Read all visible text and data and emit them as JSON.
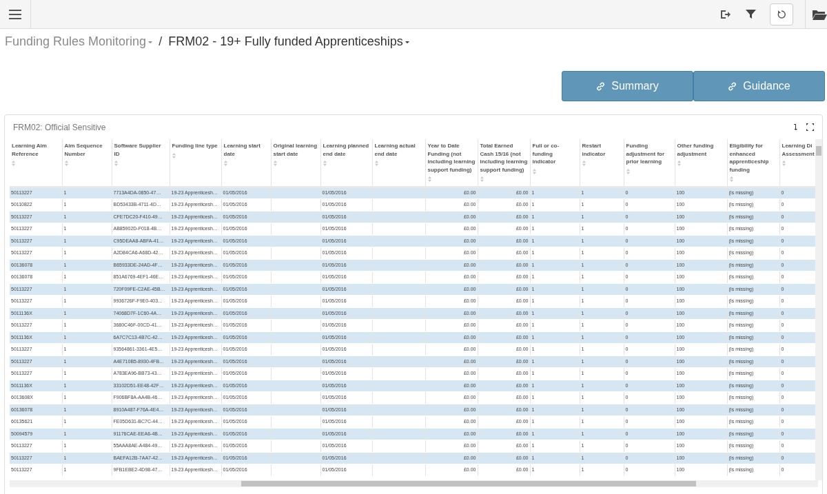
{
  "breadcrumb": {
    "separator": "/",
    "items": [
      {
        "label": "Funding Rules Monitoring",
        "current": false
      },
      {
        "label": "FRM02 - 19+ Fully funded Apprenticeships",
        "current": true
      }
    ]
  },
  "buttons": [
    {
      "label": "Summary"
    },
    {
      "label": "Guidance"
    }
  ],
  "panel": {
    "title": "FRM02: Official Sensitive"
  },
  "table": {
    "columns": [
      {
        "label": "Learning Aim Reference",
        "kind": "text"
      },
      {
        "label": "Aim Sequence Number",
        "kind": "text"
      },
      {
        "label": "Software Supplier ID",
        "kind": "text"
      },
      {
        "label": "Funding line type",
        "kind": "text"
      },
      {
        "label": "Learning start date",
        "kind": "text"
      },
      {
        "label": "Original learning start date",
        "kind": "text"
      },
      {
        "label": "Learning planned end date",
        "kind": "text"
      },
      {
        "label": "Learning actual end date",
        "kind": "text"
      },
      {
        "label": "Year to Date Funding (not including learning support funding)",
        "kind": "money"
      },
      {
        "label": "Total Earned Cash 15/16 (not including learning support funding)",
        "kind": "money"
      },
      {
        "label": "Full or co-funding indicator",
        "kind": "text"
      },
      {
        "label": "Restart indicator",
        "kind": "text"
      },
      {
        "label": "Funding adjustment for prior learning",
        "kind": "text"
      },
      {
        "label": "Other funding adjustment",
        "kind": "text"
      },
      {
        "label": "Eligibility for enhanced apprenticeship funding",
        "kind": "text"
      },
      {
        "label": "Learning Di Assessment",
        "kind": "text"
      }
    ],
    "rows": [
      [
        "50113227",
        "1",
        "7713A4DA-0850-47…",
        "19-23 Apprenticesh…",
        "01/05/2016",
        "",
        "01/05/2016",
        "",
        "£0.00",
        "£0.00",
        "1",
        "1",
        "0",
        "100",
        "(Is missing)",
        "0"
      ],
      [
        "50110822",
        "1",
        "BD53433B-4711-4D…",
        "19-23 Apprenticesh…",
        "01/05/2016",
        "",
        "01/05/2016",
        "",
        "£0.00",
        "£0.00",
        "1",
        "1",
        "0",
        "100",
        "(Is missing)",
        "0"
      ],
      [
        "50113227",
        "1",
        "CFE7DC20-F410-49…",
        "19-23 Apprenticesh…",
        "01/05/2016",
        "",
        "01/05/2016",
        "",
        "£0.00",
        "£0.00",
        "1",
        "1",
        "0",
        "100",
        "(Is missing)",
        "0"
      ],
      [
        "50113227",
        "1",
        "AB85902D-F018-4B…",
        "19-23 Apprenticesh…",
        "01/05/2016",
        "",
        "01/05/2016",
        "",
        "£0.00",
        "£0.00",
        "1",
        "1",
        "0",
        "100",
        "(Is missing)",
        "0"
      ],
      [
        "50113227",
        "1",
        "C95DEAA8-ABFA-41…",
        "19-23 Apprenticesh…",
        "01/05/2016",
        "",
        "01/05/2016",
        "",
        "£0.00",
        "£0.00",
        "1",
        "1",
        "0",
        "100",
        "(Is missing)",
        "0"
      ],
      [
        "50113227",
        "1",
        "A2D84CA6-A68D-42…",
        "19-23 Apprenticesh…",
        "01/05/2016",
        "",
        "01/05/2016",
        "",
        "£0.00",
        "£0.00",
        "1",
        "1",
        "0",
        "100",
        "(Is missing)",
        "0"
      ],
      [
        "60136078",
        "1",
        "B65933DE-24AD-4F…",
        "19-23 Apprenticesh…",
        "01/05/2016",
        "",
        "01/05/2016",
        "",
        "£0.00",
        "£0.00",
        "1",
        "1",
        "0",
        "100",
        "(Is missing)",
        "0"
      ],
      [
        "60136078",
        "1",
        "851A6769-4EF1-46E…",
        "19-23 Apprenticesh…",
        "01/05/2016",
        "",
        "01/05/2016",
        "",
        "£0.00",
        "£0.00",
        "1",
        "1",
        "0",
        "100",
        "(Is missing)",
        "0"
      ],
      [
        "50113227",
        "1",
        "720F09FE-C2AE-45B…",
        "19-23 Apprenticesh…",
        "01/05/2016",
        "",
        "01/05/2016",
        "",
        "£0.00",
        "£0.00",
        "1",
        "1",
        "0",
        "100",
        "(Is missing)",
        "0"
      ],
      [
        "50113227",
        "1",
        "9936726F-F9E0-403…",
        "19-23 Apprenticesh…",
        "01/05/2016",
        "",
        "01/05/2016",
        "",
        "£0.00",
        "£0.00",
        "1",
        "1",
        "0",
        "100",
        "(Is missing)",
        "0"
      ],
      [
        "5011136X",
        "1",
        "74068D7F-1C60-4A…",
        "19-23 Apprenticesh…",
        "01/05/2016",
        "",
        "01/05/2016",
        "",
        "£0.00",
        "£0.00",
        "1",
        "1",
        "0",
        "100",
        "(Is missing)",
        "0"
      ],
      [
        "50113227",
        "1",
        "3680C46F-00CD-41…",
        "19-23 Apprenticesh…",
        "01/05/2016",
        "",
        "01/05/2016",
        "",
        "£0.00",
        "£0.00",
        "1",
        "1",
        "0",
        "100",
        "(Is missing)",
        "0"
      ],
      [
        "5011136X",
        "1",
        "6A7C7C13-4B7C-42…",
        "19-23 Apprenticesh…",
        "01/05/2016",
        "",
        "01/05/2016",
        "",
        "£0.00",
        "£0.00",
        "1",
        "1",
        "0",
        "100",
        "(Is missing)",
        "0"
      ],
      [
        "50113227",
        "1",
        "93564861-3361-4E5…",
        "19-23 Apprenticesh…",
        "01/05/2016",
        "",
        "01/05/2016",
        "",
        "£0.00",
        "£0.00",
        "1",
        "1",
        "0",
        "100",
        "(Is missing)",
        "0"
      ],
      [
        "50113227",
        "1",
        "A4E710B5-8930-4FB…",
        "19-23 Apprenticesh…",
        "01/05/2016",
        "",
        "01/05/2016",
        "",
        "£0.00",
        "£0.00",
        "1",
        "1",
        "0",
        "100",
        "(Is missing)",
        "0"
      ],
      [
        "50113227",
        "1",
        "A783EA96-BB73-43…",
        "19-23 Apprenticesh…",
        "01/05/2016",
        "",
        "01/05/2016",
        "",
        "£0.00",
        "£0.00",
        "1",
        "1",
        "0",
        "100",
        "(Is missing)",
        "0"
      ],
      [
        "5011136X",
        "1",
        "33102D51-EE48-42F…",
        "19-23 Apprenticesh…",
        "01/05/2016",
        "",
        "01/05/2016",
        "",
        "£0.00",
        "£0.00",
        "1",
        "1",
        "0",
        "100",
        "(Is missing)",
        "0"
      ],
      [
        "6013608X",
        "1",
        "F906BF8A-AA4B-46…",
        "19-23 Apprenticesh…",
        "01/05/2016",
        "",
        "01/05/2016",
        "",
        "£0.00",
        "£0.00",
        "1",
        "1",
        "0",
        "100",
        "(Is missing)",
        "0"
      ],
      [
        "60136078",
        "1",
        "8910A487-F76A-4E4…",
        "19-23 Apprenticesh…",
        "01/05/2016",
        "",
        "01/05/2016",
        "",
        "£0.00",
        "£0.00",
        "1",
        "1",
        "0",
        "100",
        "(Is missing)",
        "0"
      ],
      [
        "60135621",
        "1",
        "FE05D631-BC7C-44…",
        "19-23 Apprenticesh…",
        "01/05/2016",
        "",
        "01/05/2016",
        "",
        "£0.00",
        "£0.00",
        "1",
        "1",
        "0",
        "100",
        "(Is missing)",
        "0"
      ],
      [
        "50094579",
        "1",
        "91176CAE-EEA6-4B…",
        "19-23 Apprenticesh…",
        "01/05/2016",
        "",
        "01/05/2016",
        "",
        "£0.00",
        "£0.00",
        "1",
        "1",
        "0",
        "100",
        "(Is missing)",
        "0"
      ],
      [
        "50113227",
        "1",
        "55AAA8AE-A484-49…",
        "19-23 Apprenticesh…",
        "01/05/2016",
        "",
        "01/05/2016",
        "",
        "£0.00",
        "£0.00",
        "1",
        "1",
        "0",
        "100",
        "(Is missing)",
        "0"
      ],
      [
        "50113227",
        "1",
        "BAEFA12B-7AA7-42…",
        "19-23 Apprenticesh…",
        "01/05/2016",
        "",
        "01/05/2016",
        "",
        "£0.00",
        "£0.00",
        "1",
        "1",
        "0",
        "100",
        "(Is missing)",
        "0"
      ],
      [
        "50113227",
        "1",
        "9FB1EBE2-4D98-47…",
        "19-23 Apprenticesh…",
        "01/05/2016",
        "",
        "01/05/2016",
        "",
        "£0.00",
        "£0.00",
        "1",
        "1",
        "0",
        "100",
        "(Is missing)",
        "0"
      ]
    ]
  }
}
